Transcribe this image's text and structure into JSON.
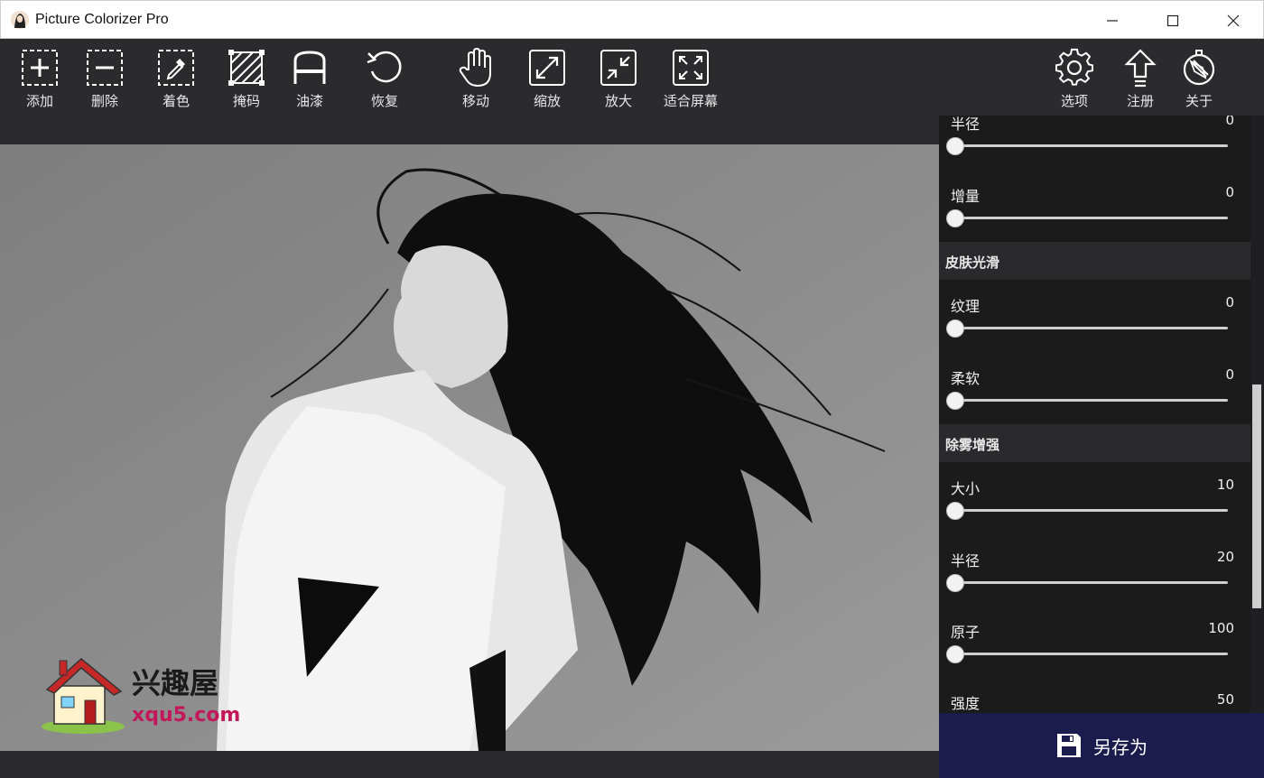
{
  "window": {
    "title": "Picture Colorizer Pro",
    "controls": [
      "minimize",
      "maximize",
      "close"
    ]
  },
  "toolbar": {
    "left_tools": [
      {
        "label": "添加",
        "icon": "add-square-icon"
      },
      {
        "label": "删除",
        "icon": "remove-square-icon"
      },
      {
        "label": "着色",
        "icon": "eyedropper-icon"
      },
      {
        "label": "掩码",
        "icon": "mask-icon"
      },
      {
        "label": "油漆",
        "icon": "paint-icon"
      },
      {
        "label": "恢复",
        "icon": "undo-icon"
      },
      {
        "label": "移动",
        "icon": "hand-icon"
      },
      {
        "label": "缩放",
        "icon": "zoom-out-icon"
      },
      {
        "label": "放大",
        "icon": "zoom-in-icon"
      },
      {
        "label": "适合屏幕",
        "icon": "fit-screen-icon"
      }
    ],
    "right_tools": [
      {
        "label": "选项",
        "icon": "gear-icon"
      },
      {
        "label": "注册",
        "icon": "upload-arrow-icon"
      },
      {
        "label": "关于",
        "icon": "compass-icon"
      }
    ]
  },
  "panel": {
    "rows_top": [
      {
        "name": "半径",
        "value": "0"
      },
      {
        "name": "增量",
        "value": "0"
      }
    ],
    "section_skin": {
      "title": "皮肤光滑",
      "rows": [
        {
          "name": "纹理",
          "value": "0"
        },
        {
          "name": "柔软",
          "value": "0"
        }
      ]
    },
    "section_dehaze": {
      "title": "除雾增强",
      "rows": [
        {
          "name": "大小",
          "value": "10"
        },
        {
          "name": "半径",
          "value": "20"
        },
        {
          "name": "原子",
          "value": "100"
        },
        {
          "name": "强度",
          "value": "50"
        }
      ]
    }
  },
  "save_button": {
    "label": "另存为",
    "icon": "save-disk-icon"
  },
  "watermark": {
    "line1": "兴趣屋",
    "line2": "xqu5.com"
  },
  "colors": {
    "toolbar_bg": "#2b2b2e",
    "panel_bg": "#1b1b1c",
    "section_bg": "#2a2a2c",
    "save_bg": "#1c1b4d",
    "canvas_bg": "#8b8b8b"
  }
}
